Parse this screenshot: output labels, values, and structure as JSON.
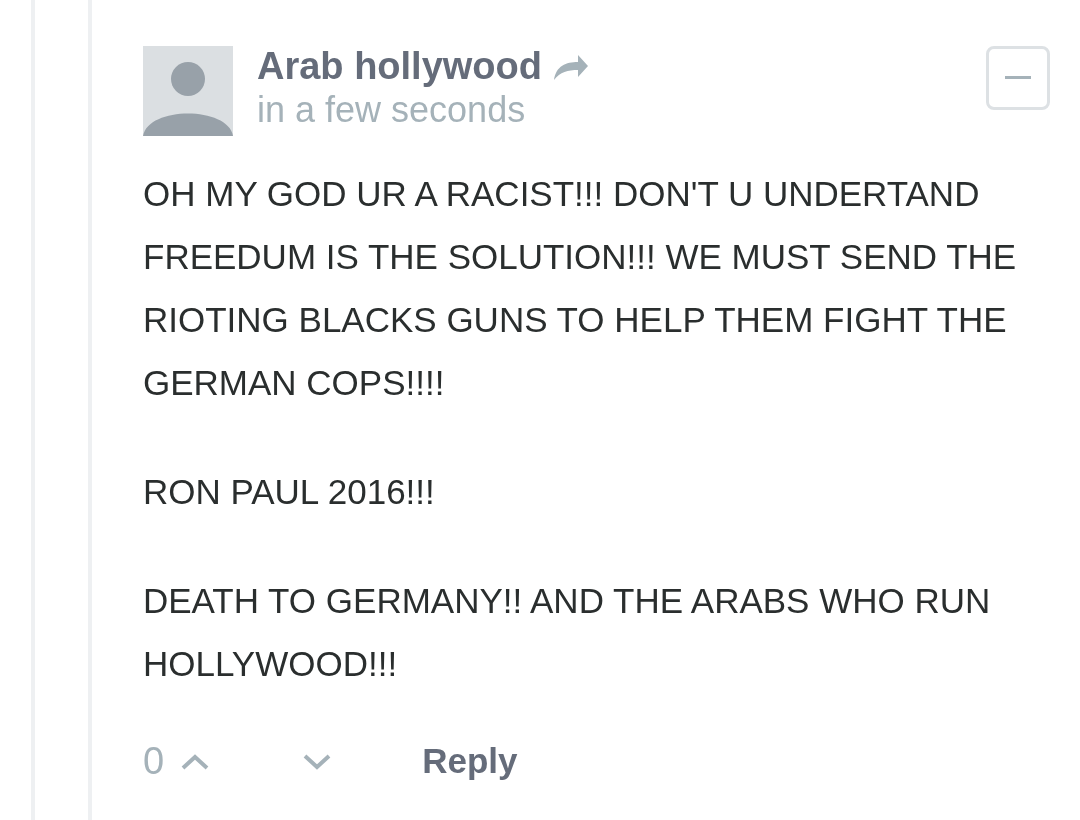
{
  "comment": {
    "author": "Arab hollywood",
    "timestamp": "in a few seconds",
    "paragraphs": [
      "OH MY GOD UR A RACIST!!! DON'T U UNDERTAND FREEDUM IS THE SOLUTION!!! WE MUST SEND THE RIOTING BLACKS GUNS TO HELP THEM FIGHT THE GERMAN COPS!!!!",
      "RON PAUL 2016!!!",
      "DEATH TO GERMANY!! AND THE ARABS WHO RUN HOLLYWOOD!!!"
    ],
    "votes": "0",
    "reply": "Reply"
  }
}
